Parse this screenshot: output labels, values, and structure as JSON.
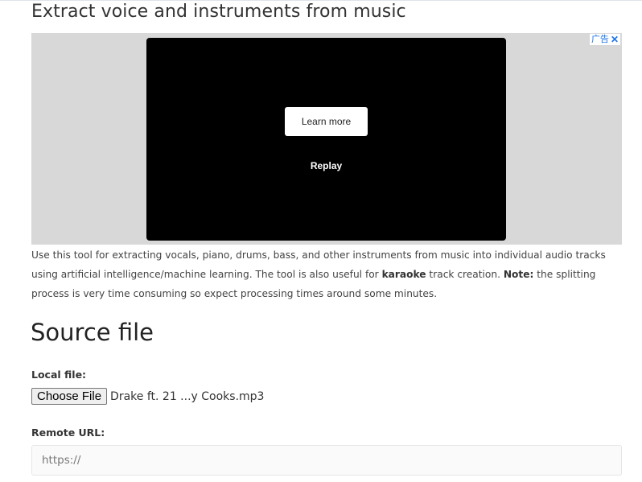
{
  "page": {
    "title": "Extract voice and instruments from music",
    "section_title": "Source file"
  },
  "ad": {
    "badge_label": "广告",
    "close_glyph": "✕",
    "learn_more": "Learn more",
    "replay": "Replay"
  },
  "description": {
    "part1": "Use this tool for extracting vocals, piano, drums, bass, and other instruments from music into individual audio tracks using artificial intelligence/machine learning. The tool is also useful for ",
    "karaoke": "karaoke",
    "part2": " track creation. ",
    "note_label": "Note:",
    "part3": " the splitting process is very time consuming so expect processing times around some minutes."
  },
  "form": {
    "local_file_label": "Local file:",
    "choose_file_button": "Choose File",
    "selected_file": "Drake ft. 21 ...y Cooks.mp3",
    "remote_url_label": "Remote URL:",
    "remote_url_placeholder": "https://",
    "remote_url_value": ""
  }
}
